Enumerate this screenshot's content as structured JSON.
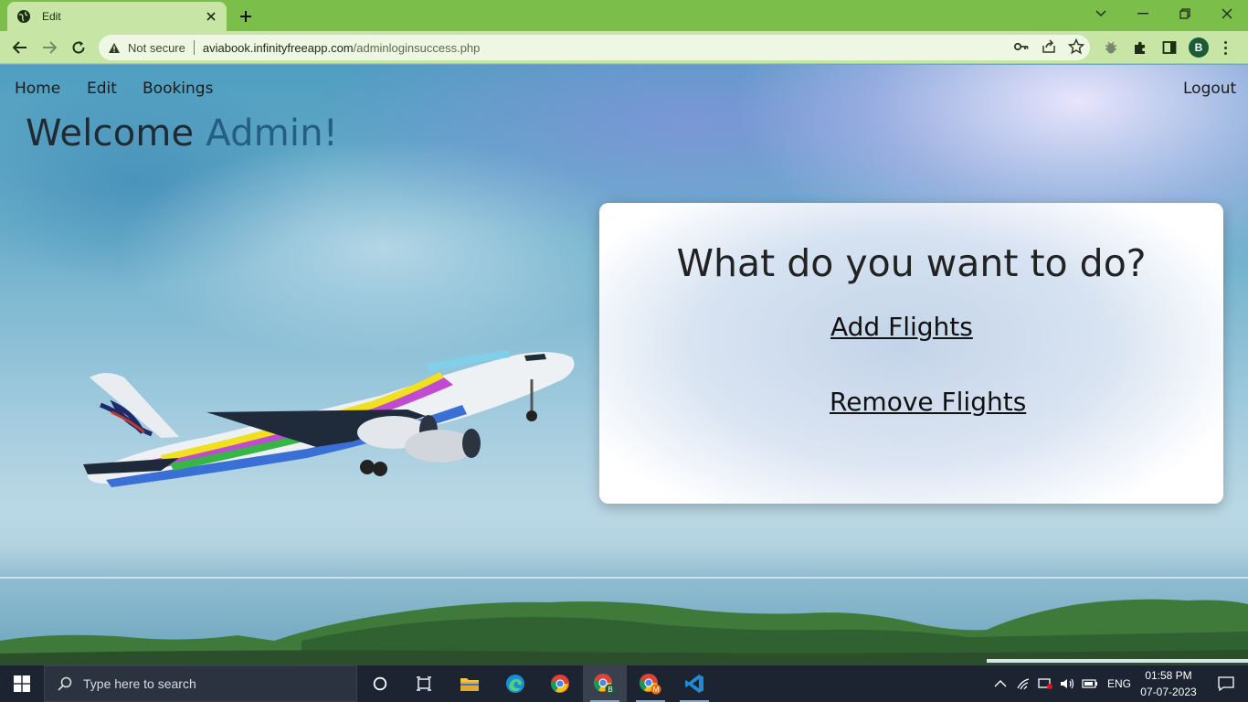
{
  "browser": {
    "tab_title": "Edit",
    "security_label": "Not secure",
    "url_host": "aviabook.infinityfreeapp.com",
    "url_path": "/adminloginsuccess.php",
    "profile_initial": "B"
  },
  "nav": {
    "home": "Home",
    "edit": "Edit",
    "bookings": "Bookings",
    "logout": "Logout"
  },
  "welcome": {
    "prefix": "Welcome",
    "name": "Admin!"
  },
  "card": {
    "heading": "What do you want to do?",
    "add_flights": "Add Flights",
    "remove_flights": "Remove Flights"
  },
  "taskbar": {
    "search_placeholder": "Type here to search",
    "language": "ENG",
    "time": "01:58 PM",
    "date": "07-07-2023"
  },
  "colors": {
    "tab_strip": "#7bbf4a",
    "toolbar": "#c7e6a6",
    "admin_accent": "#245e80",
    "taskbar": "#1c2431"
  }
}
